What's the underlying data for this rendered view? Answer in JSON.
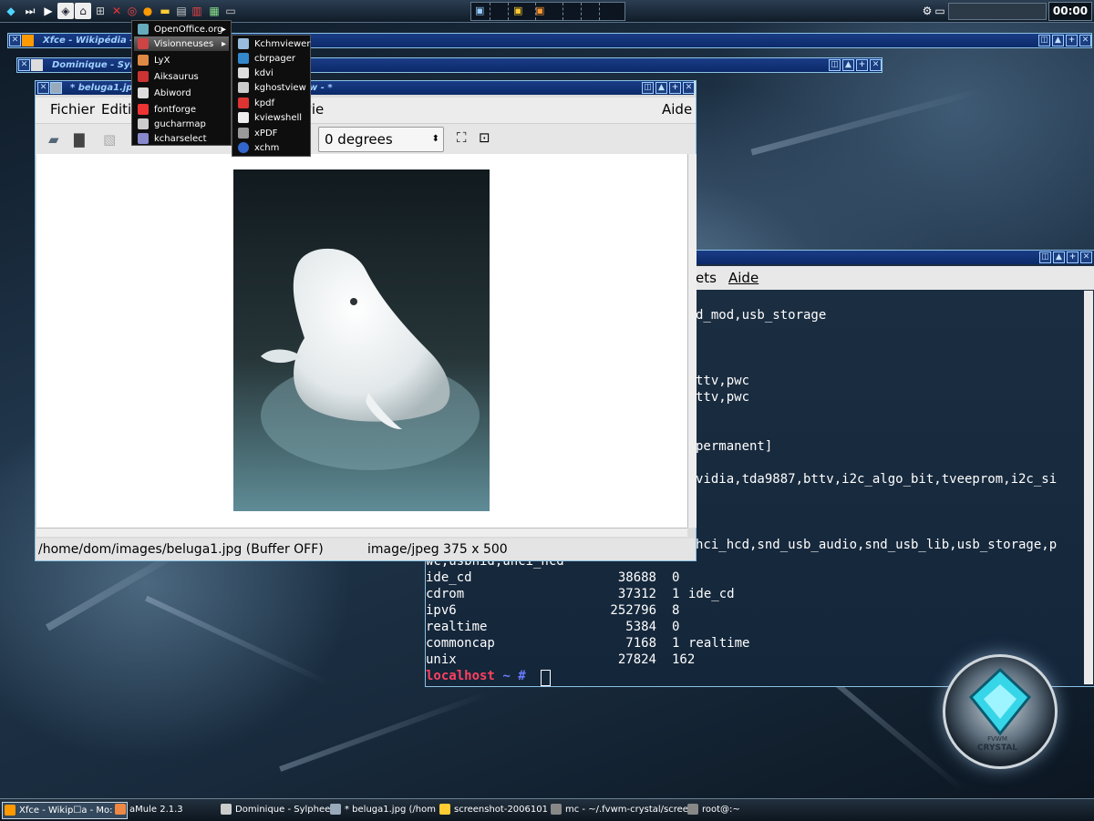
{
  "top_panel": {
    "clock": "00:00",
    "launcher_icons": [
      "crystal-icon",
      "skip-forward-icon",
      "play-icon",
      "kde-icon",
      "home-icon",
      "network-icon",
      "x-icon",
      "lifebuoy-icon",
      "firefox-icon",
      "folder-icon",
      "settings-icon",
      "book-icon",
      "calculator-icon",
      "monitor-icon"
    ]
  },
  "windows": {
    "wikipedia": {
      "title": "Xfce - Wikipédia - "
    },
    "sylpheed": {
      "title": "Dominique - Sylp"
    },
    "viewer": {
      "title": "* beluga1.jp",
      "title_suffix": "w - *"
    }
  },
  "viewer": {
    "menu": {
      "fichier": "Fichier",
      "edition": "Editi",
      "vie": "vie",
      "aide": "Aide"
    },
    "rotation_select": "0 degrees",
    "status": {
      "path": "/home/dom/images/beluga1.jpg (Buffer OFF)",
      "info": "image/jpeg 375 x 500"
    }
  },
  "terminal": {
    "menu": {
      "signets": "ets",
      "aide": "Aide"
    },
    "lines": [
      "d_mod,usb_storage",
      "",
      "",
      "",
      "ttv,pwc",
      "ttv,pwc",
      "",
      "",
      "permanent]",
      "",
      "vidia,tda9887,bttv,i2c_algo_bit,tveeprom,i2c_si",
      "",
      "",
      "",
      "hci_hcd,snd_usb_audio,snd_usb_lib,usb_storage,p",
      "wc,usbhid,uhci_hcd"
    ],
    "modules": [
      {
        "name": "ide_cd",
        "size": "38688",
        "used": "0",
        "by": ""
      },
      {
        "name": "cdrom",
        "size": "37312",
        "used": "1",
        "by": "ide_cd"
      },
      {
        "name": "ipv6",
        "size": "252796",
        "used": "8",
        "by": ""
      },
      {
        "name": "realtime",
        "size": "5384",
        "used": "0",
        "by": ""
      },
      {
        "name": "commoncap",
        "size": "7168",
        "used": "1",
        "by": "realtime"
      },
      {
        "name": "unix",
        "size": "27824",
        "used": "162",
        "by": ""
      }
    ],
    "prompt_host": "localhost",
    "prompt_rest": " ~ #"
  },
  "menu_main": [
    "OpenOffice.org",
    "Visionneuses",
    "LyX",
    "Aiksaurus",
    "Abiword",
    "fontforge",
    "gucharmap",
    "kcharselect"
  ],
  "menu_sub": [
    "Kchmviewer",
    "cbrpager",
    "kdvi",
    "kghostview",
    "kpdf",
    "kviewshell",
    "xPDF",
    "xchm"
  ],
  "taskbar": [
    "Xfce - Wikip☐a - Mo:",
    "aMule 2.1.3",
    "Dominique - Sylphee",
    "* beluga1.jpg (/hom",
    "screenshot-2006101",
    "mc - ~/.fvwm-crystal/screen",
    "root@:~"
  ],
  "logo": {
    "line1": "FVWM",
    "line2": "CRYSTAL"
  },
  "colors": {
    "title_bar": "#0c2a6a",
    "title_text": "#9fd0ff",
    "prompt": "#ff4060",
    "prompt_hash": "#6a7cff"
  }
}
